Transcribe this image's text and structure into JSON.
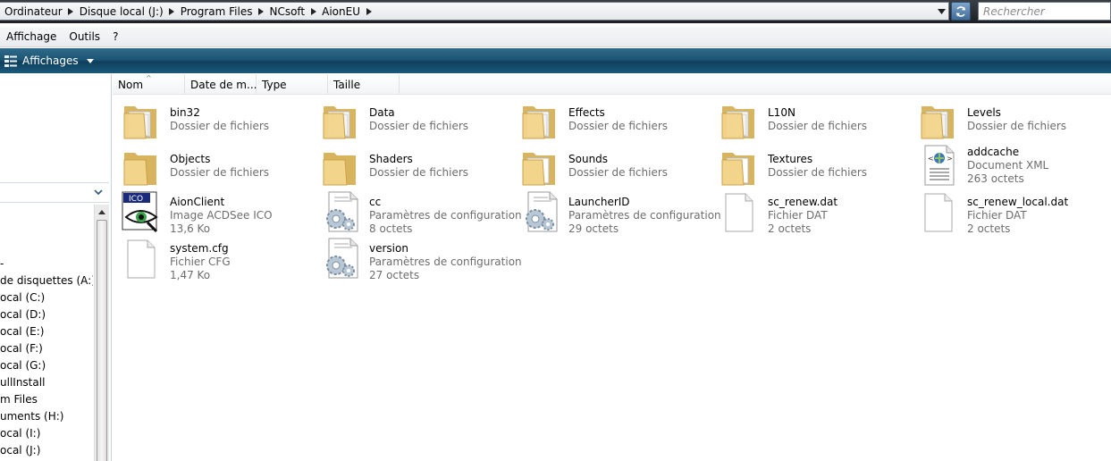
{
  "address": {
    "crumbs": [
      "Ordinateur",
      "Disque local (J:)",
      "Program Files",
      "NCsoft",
      "AionEU"
    ]
  },
  "search": {
    "placeholder": "Rechercher"
  },
  "menu": {
    "items": [
      "Affichage",
      "Outils",
      "?"
    ]
  },
  "toolbar": {
    "views_label": "Affichages"
  },
  "columns": [
    "Nom",
    "Date de m...",
    "Type",
    "Taille"
  ],
  "nav": {
    "items": [
      "de disquettes (A:)",
      "ocal (C:)",
      "ocal (D:)",
      "ocal (E:)",
      "ocal (F:)",
      "ocal (G:)",
      "ullInstall",
      "m Files",
      "uments (H:)",
      "ocal (I:)",
      "ocal (J:)"
    ]
  },
  "files": [
    {
      "name": "bin32",
      "type": "Dossier de fichiers",
      "size": "",
      "icon": "folder-icon"
    },
    {
      "name": "Data",
      "type": "Dossier de fichiers",
      "size": "",
      "icon": "folder-icon"
    },
    {
      "name": "Effects",
      "type": "Dossier de fichiers",
      "size": "",
      "icon": "folder-icon"
    },
    {
      "name": "L10N",
      "type": "Dossier de fichiers",
      "size": "",
      "icon": "folder-icon"
    },
    {
      "name": "Levels",
      "type": "Dossier de fichiers",
      "size": "",
      "icon": "folder-icon"
    },
    {
      "name": "Objects",
      "type": "Dossier de fichiers",
      "size": "",
      "icon": "folder-icon"
    },
    {
      "name": "Shaders",
      "type": "Dossier de fichiers",
      "size": "",
      "icon": "folder-icon"
    },
    {
      "name": "Sounds",
      "type": "Dossier de fichiers",
      "size": "",
      "icon": "folder-icon"
    },
    {
      "name": "Textures",
      "type": "Dossier de fichiers",
      "size": "",
      "icon": "folder-icon"
    },
    {
      "name": "addcache",
      "type": "Document XML",
      "size": "263 octets",
      "icon": "xml-document-icon"
    },
    {
      "name": "AionClient",
      "type": "Image ACDSee ICO",
      "size": "13,6 Ko",
      "icon": "ico-image-icon"
    },
    {
      "name": "cc",
      "type": "Paramètres de configuration",
      "size": "8 octets",
      "icon": "config-file-icon"
    },
    {
      "name": "LauncherID",
      "type": "Paramètres de configuration",
      "size": "29 octets",
      "icon": "config-file-icon"
    },
    {
      "name": "sc_renew.dat",
      "type": "Fichier DAT",
      "size": "2 octets",
      "icon": "blank-file-icon"
    },
    {
      "name": "sc_renew_local.dat",
      "type": "Fichier DAT",
      "size": "2 octets",
      "icon": "blank-file-icon"
    },
    {
      "name": "system.cfg",
      "type": "Fichier CFG",
      "size": "1,47 Ko",
      "icon": "blank-file-icon"
    },
    {
      "name": "version",
      "type": "Paramètres de configuration",
      "size": "27 octets",
      "icon": "config-file-icon"
    }
  ],
  "colors": {
    "toolbar": "#1d5675",
    "folder": "#f2d48a",
    "subtext": "#6d6d6d"
  }
}
